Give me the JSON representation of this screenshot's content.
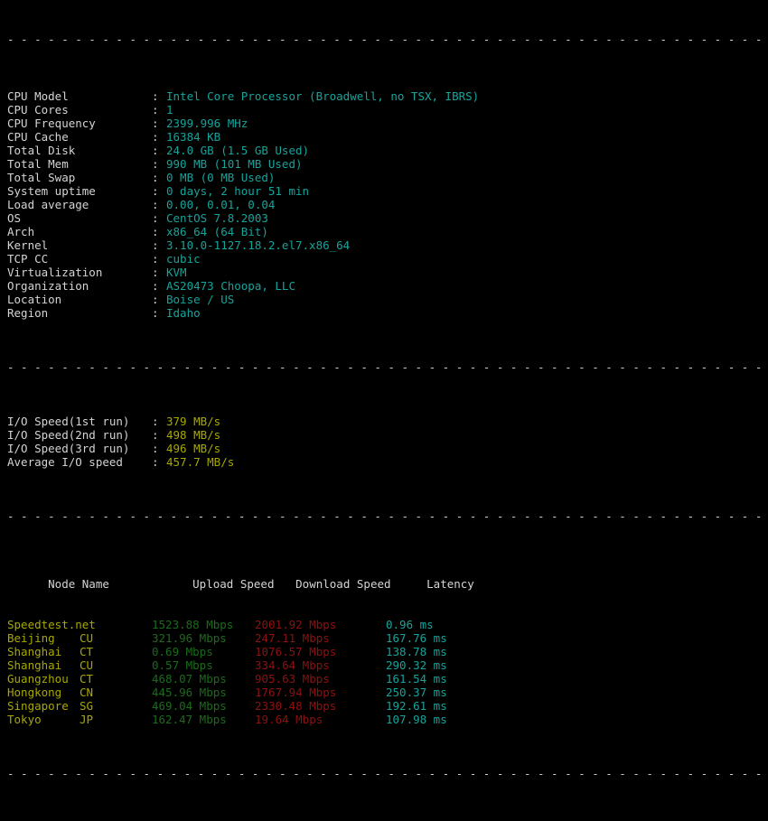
{
  "terminal": {
    "background": "#000000",
    "separator_line": "- - - - - - - - - - - - - - - - - - - - - - - - - - - - - - - - - - - - - - - - - - - - - - - - - - - - - - - - - -",
    "colon": ":",
    "colors": {
      "label": "#d4d4d4",
      "value_teal": "#16a39a",
      "value_olive": "#a8a800",
      "node_name": "#a8a800",
      "upload": "#1b6b1b",
      "download": "#8d1111",
      "latency": "#16a39a"
    }
  },
  "system_info": [
    {
      "label": "CPU Model",
      "value": "Intel Core Processor (Broadwell, no TSX, IBRS)"
    },
    {
      "label": "CPU Cores",
      "value": "1"
    },
    {
      "label": "CPU Frequency",
      "value": "2399.996 MHz"
    },
    {
      "label": "CPU Cache",
      "value": "16384 KB"
    },
    {
      "label": "Total Disk",
      "value": "24.0 GB (1.5 GB Used)"
    },
    {
      "label": "Total Mem",
      "value": "990 MB (101 MB Used)"
    },
    {
      "label": "Total Swap",
      "value": "0 MB (0 MB Used)"
    },
    {
      "label": "System uptime",
      "value": "0 days, 2 hour 51 min"
    },
    {
      "label": "Load average",
      "value": "0.00, 0.01, 0.04"
    },
    {
      "label": "OS",
      "value": "CentOS 7.8.2003"
    },
    {
      "label": "Arch",
      "value": "x86_64 (64 Bit)"
    },
    {
      "label": "Kernel",
      "value": "3.10.0-1127.18.2.el7.x86_64"
    },
    {
      "label": "TCP CC",
      "value": "cubic"
    },
    {
      "label": "Virtualization",
      "value": "KVM"
    },
    {
      "label": "Organization",
      "value": "AS20473 Choopa, LLC"
    },
    {
      "label": "Location",
      "value": "Boise / US"
    },
    {
      "label": "Region",
      "value": "Idaho"
    }
  ],
  "io_tests": [
    {
      "label": "I/O Speed(1st run)",
      "value": "379 MB/s"
    },
    {
      "label": "I/O Speed(2nd run)",
      "value": "498 MB/s"
    },
    {
      "label": "I/O Speed(3rd run)",
      "value": "496 MB/s"
    },
    {
      "label": "Average I/O speed",
      "value": "457.7 MB/s"
    }
  ],
  "speedtest": {
    "headers": {
      "node": "Node Name",
      "upload": "Upload Speed",
      "download": "Download Speed",
      "latency": "Latency"
    },
    "rows": [
      {
        "node": "Speedtest.net",
        "cc": "",
        "upload": "1523.88 Mbps",
        "download": "2001.92 Mbps",
        "latency": "0.96 ms"
      },
      {
        "node": "Beijing",
        "cc": "CU",
        "upload": "321.96 Mbps",
        "download": "247.11 Mbps",
        "latency": "167.76 ms"
      },
      {
        "node": "Shanghai",
        "cc": "CT",
        "upload": "0.69 Mbps",
        "download": "1076.57 Mbps",
        "latency": "138.78 ms"
      },
      {
        "node": "Shanghai",
        "cc": "CU",
        "upload": "0.57 Mbps",
        "download": "334.64 Mbps",
        "latency": "290.32 ms"
      },
      {
        "node": "Guangzhou",
        "cc": "CT",
        "upload": "468.07 Mbps",
        "download": "905.63 Mbps",
        "latency": "161.54 ms"
      },
      {
        "node": "Hongkong",
        "cc": "CN",
        "upload": "445.96 Mbps",
        "download": "1767.94 Mbps",
        "latency": "250.37 ms"
      },
      {
        "node": "Singapore",
        "cc": "SG",
        "upload": "469.04 Mbps",
        "download": "2330.48 Mbps",
        "latency": "192.61 ms"
      },
      {
        "node": "Tokyo",
        "cc": "JP",
        "upload": "162.47 Mbps",
        "download": "19.64 Mbps",
        "latency": "107.98 ms"
      }
    ]
  }
}
